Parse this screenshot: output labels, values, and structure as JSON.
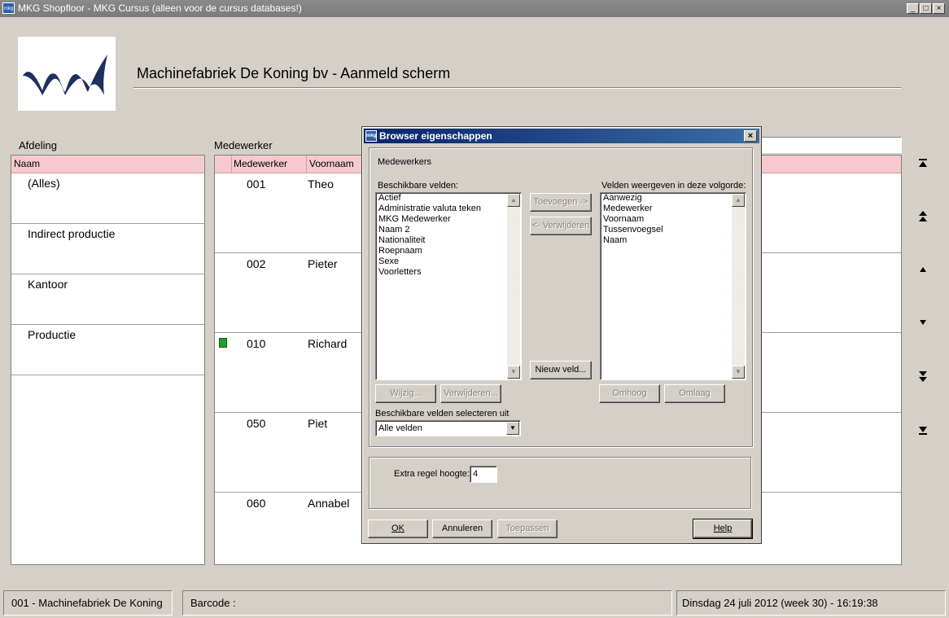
{
  "window": {
    "app_icon_text": "mkg",
    "title": "MKG Shopfloor - MKG Cursus (alleen voor de cursus databases!)",
    "controls": [
      "_",
      "□",
      "×"
    ]
  },
  "header": {
    "company_title": "Machinefabriek De Koning bv  -  Aanmeld scherm"
  },
  "afdeling": {
    "label": "Afdeling",
    "column_header": "Naam",
    "rows": [
      "(Alles)",
      "Indirect productie",
      "Kantoor",
      "Productie"
    ]
  },
  "medewerker": {
    "label": "Medewerker",
    "columns": [
      "Medewerker",
      "Voornaam"
    ],
    "rows": [
      {
        "nummer": "001",
        "voornaam": "Theo",
        "aanwezig": false
      },
      {
        "nummer": "002",
        "voornaam": "Pieter",
        "aanwezig": false
      },
      {
        "nummer": "010",
        "voornaam": "Richard",
        "aanwezig": true
      },
      {
        "nummer": "050",
        "voornaam": "Piet",
        "aanwezig": false
      },
      {
        "nummer": "060",
        "voornaam": "Annabel",
        "aanwezig": false
      }
    ]
  },
  "nav_icons": [
    "first-page-icon",
    "page-up-icon",
    "row-up-icon",
    "row-down-icon",
    "page-down-icon",
    "last-page-icon"
  ],
  "status_bar": {
    "company": "001 - Machinefabriek De Koning",
    "barcode_label": "Barcode :",
    "datetime": "Dinsdag 24 juli 2012 (week 30)  -  16:19:38"
  },
  "dialog": {
    "title": "Browser eigenschappen",
    "group_title": "Medewerkers",
    "available_label": "Beschikbare velden:",
    "available_fields": [
      "Actief",
      "Administratie valuta teken",
      "MKG Medewerker",
      "Naam 2",
      "Nationaliteit",
      "Roepnaam",
      "Sexe",
      "Voorletters"
    ],
    "display_label": "Velden weergeven in deze volgorde:",
    "display_fields": [
      "Aanwezig",
      "Medewerker",
      "Voornaam",
      "Tussenvoegsel",
      "Naam"
    ],
    "btn_toevoegen": "Toevoegen ->",
    "btn_verwijderen_mid": "<- Verwijderen",
    "btn_nieuw_veld": "Nieuw veld...",
    "btn_wijzig": "Wijzig...",
    "btn_verwijderen": "Verwijderen...",
    "btn_omhoog": "Omhoog",
    "btn_omlaag": "Omlaag",
    "select_label": "Beschikbare velden selecteren uit",
    "select_value": "Alle velden",
    "extra_label": "Extra regel hoogte:",
    "extra_value": "4",
    "btn_ok": "OK",
    "btn_annuleren": "Annuleren",
    "btn_toepassen": "Toepassen",
    "btn_help": "Help"
  }
}
